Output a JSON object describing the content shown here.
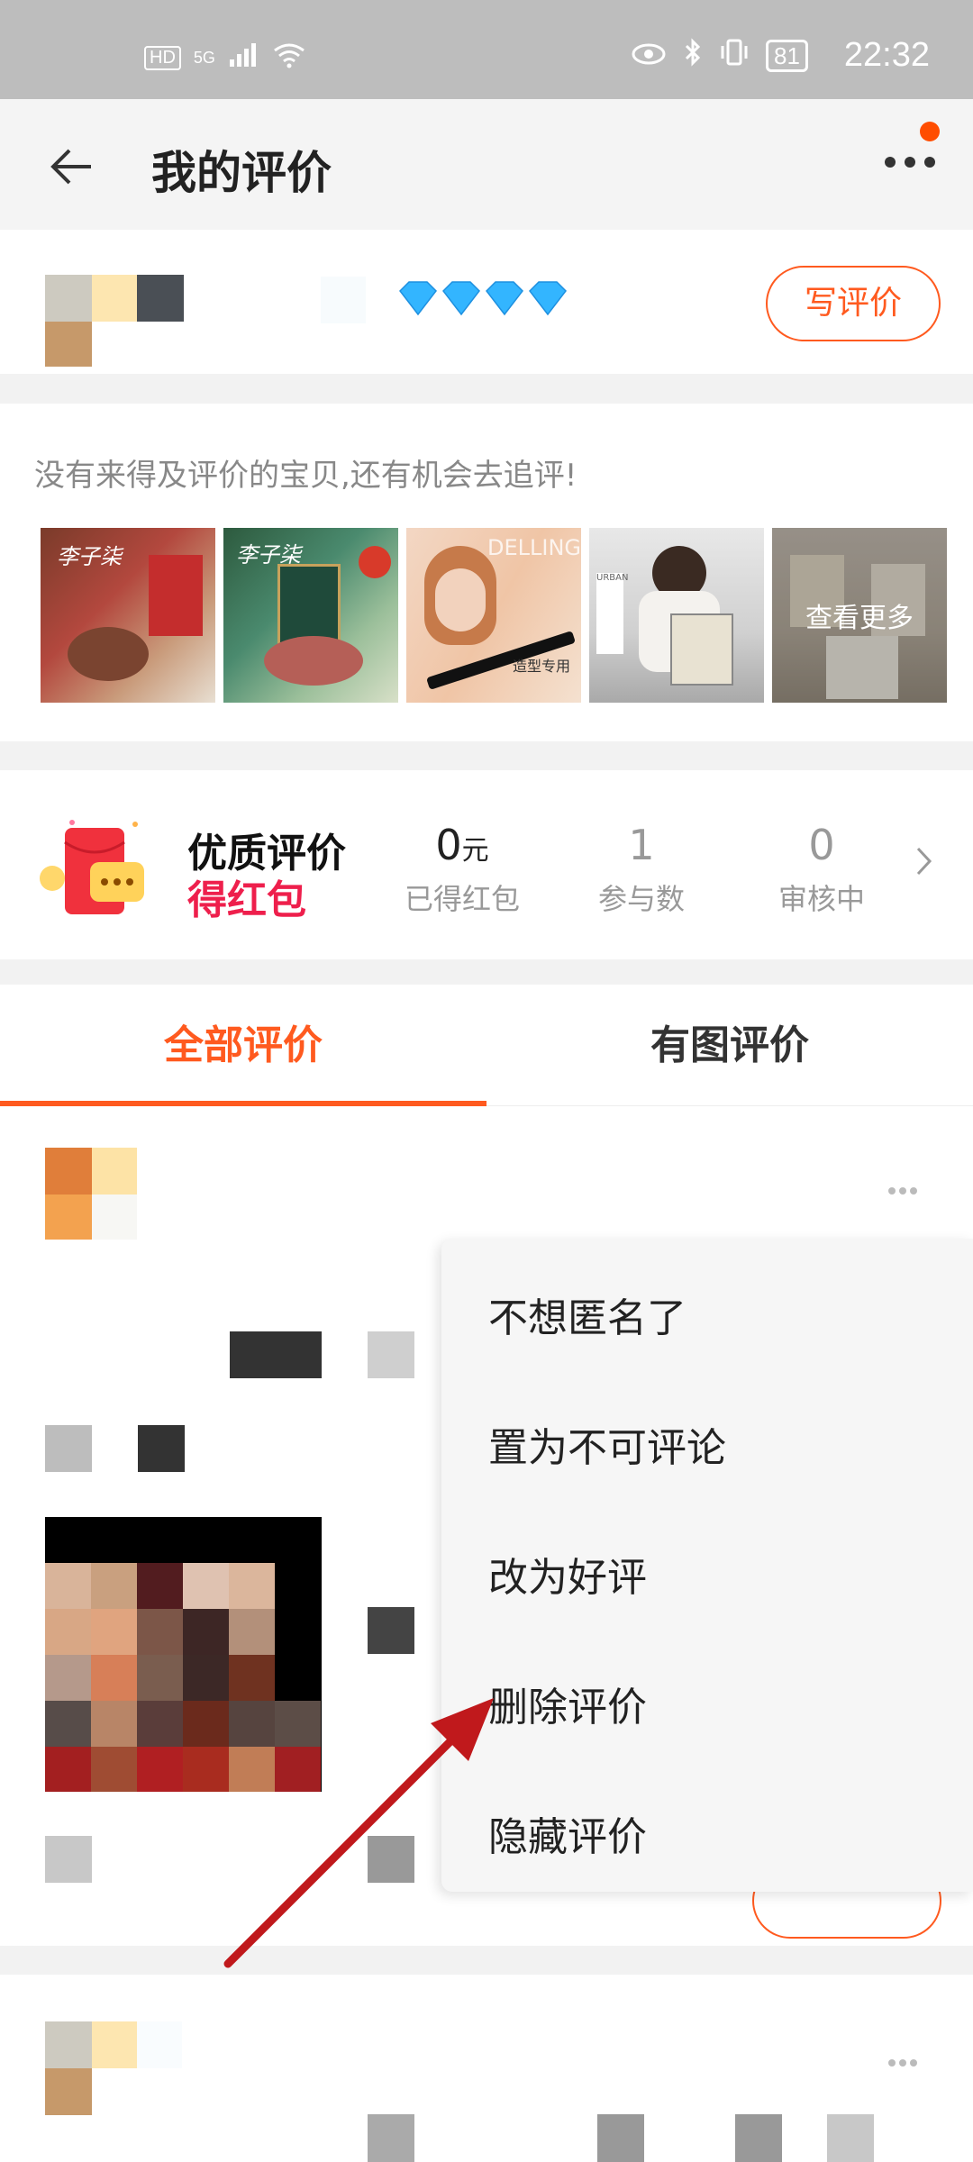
{
  "status_bar": {
    "left_icons": [
      "HD",
      "5G",
      "signal-icon",
      "wifi-icon"
    ],
    "right_icons": [
      "eye-icon",
      "bluetooth-icon",
      "vibrate-icon"
    ],
    "battery": "81",
    "time": "22:32"
  },
  "navbar": {
    "title": "我的评价",
    "back_icon": "back-arrow-icon",
    "more_icon": "more-dots-icon"
  },
  "profile": {
    "write_review_label": "写评价",
    "level_icon": "diamond-icon",
    "diamond_count": 4
  },
  "pending": {
    "hint": "没有来得及评价的宝贝,还有机会去追评!",
    "see_more_label": "查看更多"
  },
  "reward": {
    "title_line1": "优质评价",
    "title_line2": "得红包",
    "stats": [
      {
        "value": "0",
        "unit": "元",
        "label": "已得红包"
      },
      {
        "value": "1",
        "unit": "",
        "label": "参与数"
      },
      {
        "value": "0",
        "unit": "",
        "label": "审核中"
      }
    ]
  },
  "tabs": [
    {
      "label": "全部评价",
      "active": true
    },
    {
      "label": "有图评价",
      "active": false
    }
  ],
  "context_menu": {
    "items": [
      {
        "label": "不想匿名了"
      },
      {
        "label": "置为不可评论"
      },
      {
        "label": "改为好评"
      },
      {
        "label": "删除评价"
      },
      {
        "label": "隐藏评价"
      }
    ]
  },
  "colors": {
    "accent": "#ff5a1f",
    "reward_red": "#ee1f4c",
    "annotation_arrow": "#c0191c"
  }
}
